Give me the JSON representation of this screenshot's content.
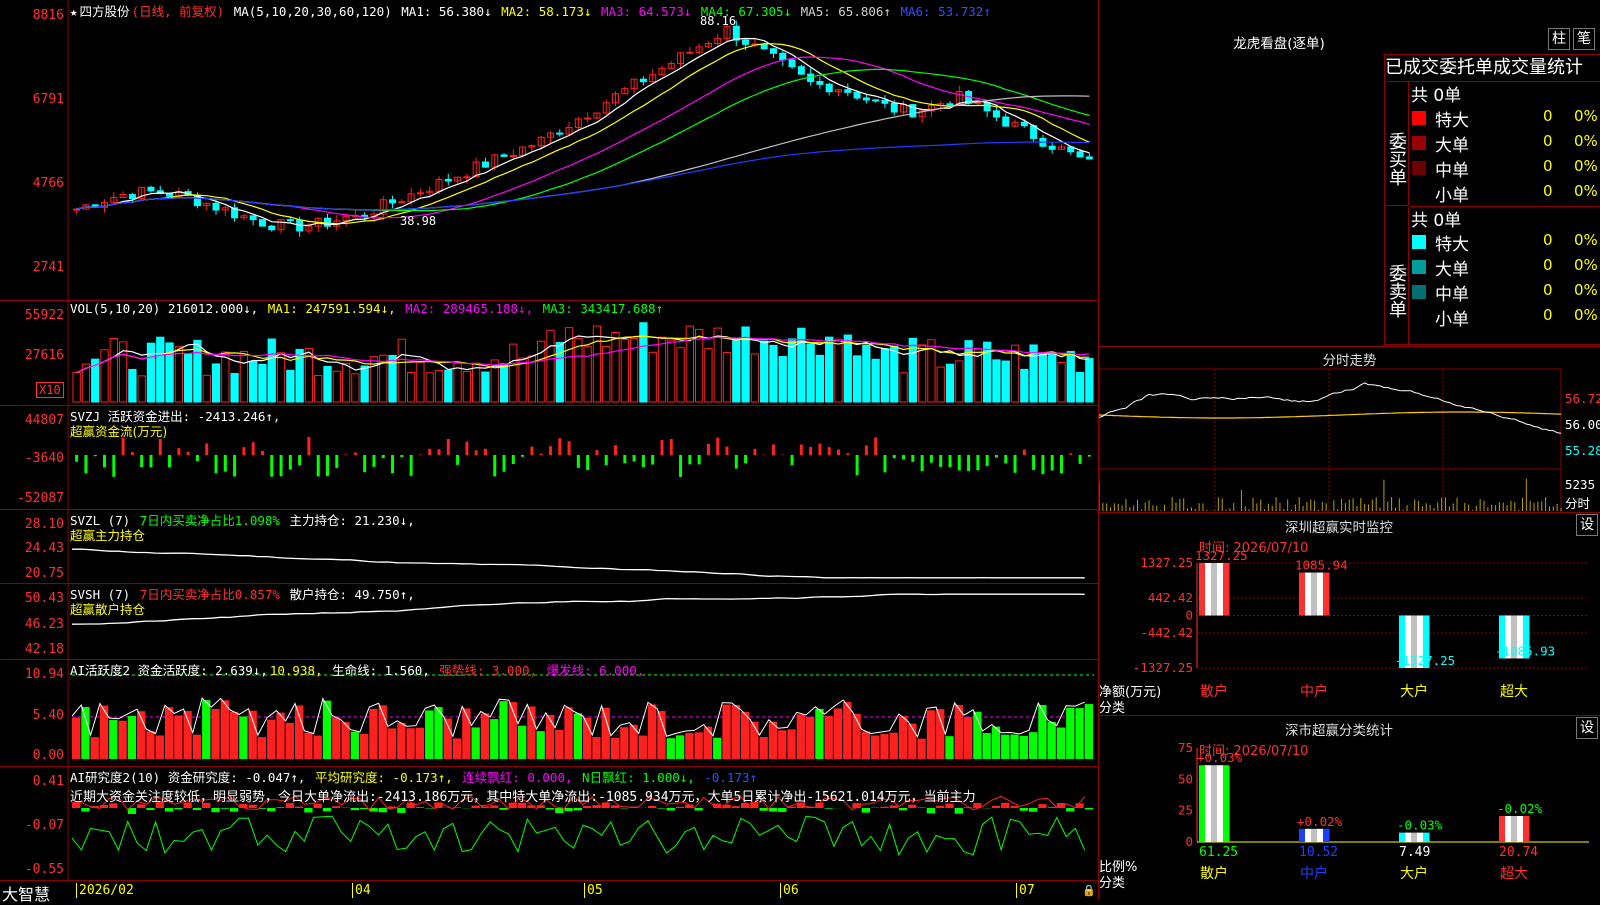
{
  "kline": {
    "star": "★",
    "name": "四方股份",
    "mode": "(日线, 前复权)",
    "ma_label": "MA(5,10,20,30,60,120)",
    "ma1": "MA1: 56.380↓",
    "ma2": "MA2: 58.173↓",
    "ma3": "MA3: 64.573↓",
    "ma4": "MA4: 67.305↓",
    "ma5": "MA5: 65.806↑",
    "ma6": "MA6: 53.732↑",
    "yticks": [
      "8816",
      "6791",
      "4766",
      "2741"
    ],
    "high_label": "88.16",
    "low_label": "38.98",
    "colors": {
      "ma1": "#ffffff",
      "ma2": "#ffff00",
      "ma3": "#ff00ff",
      "ma4": "#00ff00",
      "ma5": "#c0c0c0",
      "ma6": "#1e3cff",
      "up": "#ff2020",
      "down": "#00ffff"
    }
  },
  "vol": {
    "title": "VOL(5,10,20) 216012.000↓,",
    "ma1": "MA1: 247591.594↓,",
    "ma2": "MA2: 289465.188↓,",
    "ma3": "MA3: 343417.688↑",
    "yticks": [
      "55922",
      "27616"
    ],
    "unit": "X10"
  },
  "svzj": {
    "title": "SVZJ  活跃资金进出: -2413.246↑,",
    "sub": "超赢资金流(万元)",
    "yticks": [
      "44807",
      "-3640",
      "-52087"
    ]
  },
  "svzl": {
    "title": "SVZL (7)",
    "t2": "7日内买卖净占比1.098%",
    "t3": "主力持仓: 21.230↓,",
    "sub": "超赢主力持仓",
    "yticks": [
      "28.10",
      "24.43",
      "20.75"
    ]
  },
  "svsh": {
    "title": "SVSH (7)",
    "t2": "7日内买卖净占比0.857%",
    "t3": "散户持仓: 49.750↑,",
    "sub": "超赢散户持仓",
    "yticks": [
      "50.43",
      "46.23",
      "42.18"
    ]
  },
  "ai_active": {
    "title": "AI活跃度2 资金活跃度: 2.639↓,",
    "t2": "10.938,",
    "t3": "生命线: 1.560,",
    "t4": "强势线: 3.000,",
    "t5": "爆发线: 6.000,",
    "yticks": [
      "10.94",
      "5.40",
      "0.00"
    ]
  },
  "ai_research": {
    "title": "AI研究度2(10) 资金研究度: -0.047↑,",
    "t2": "平均研究度: -0.173↑,",
    "t3": "连续飘红: 0.000,",
    "t4": "N日飘红: 1.000↓,",
    "t5": "-0.173↑",
    "comment": "近期大资金关注度较低，明显弱势，今日大单净流出:-2413.186万元，其中特大单净流出:-1085.934万元，大单5日累计净出-15621.014万元，当前主力",
    "yticks": [
      "0.41",
      "-0.07",
      "-0.55"
    ]
  },
  "bottom_axis": {
    "brand": "大智慧",
    "dates": [
      "2026/02",
      "04",
      "05",
      "06",
      "07"
    ]
  },
  "dragon": {
    "title": "龙虎看盘(逐单)",
    "btn1": "柱",
    "btn2": "笔",
    "tabs": "已成交委托单成交量统计",
    "buy_label": "委买单",
    "sell_label": "委卖单",
    "buy_total": "共 0单",
    "sell_total": "共 0单",
    "buy_rows": [
      {
        "label": "特大",
        "value": "0",
        "pct": "0%",
        "color": "#ff0000"
      },
      {
        "label": "大单",
        "value": "0",
        "pct": "0%",
        "color": "#9b0000"
      },
      {
        "label": "中单",
        "value": "0",
        "pct": "0%",
        "color": "#6b0000"
      },
      {
        "label": "小单",
        "value": "0",
        "pct": "0%",
        "color": "#000000"
      }
    ],
    "sell_rows": [
      {
        "label": "特大",
        "value": "0",
        "pct": "0%",
        "color": "#00ffff"
      },
      {
        "label": "大单",
        "value": "0",
        "pct": "0%",
        "color": "#009c9c"
      },
      {
        "label": "中单",
        "value": "0",
        "pct": "0%",
        "color": "#007070"
      },
      {
        "label": "小单",
        "value": "0",
        "pct": "0%",
        "color": "#000000"
      }
    ]
  },
  "intraday": {
    "title": "分时走势",
    "prices": [
      "56.72",
      "56.00",
      "55.28"
    ],
    "vol": "5235",
    "vol_label": "分时"
  },
  "sz_monitor": {
    "title": "深圳超赢实时监控",
    "btn": "设",
    "time": "时间: 2026/07/10",
    "yticks": [
      "1327.25",
      "442.42",
      "0",
      "-442.42",
      "-1327.25"
    ],
    "ylabel": "净额(万元)",
    "xlabel": "分类",
    "categories": [
      "散户",
      "中户",
      "大户",
      "超大"
    ],
    "bar_labels": [
      "1327.25",
      "1085.94",
      "-1327.25",
      "-1085.93"
    ]
  },
  "sz_class": {
    "title": "深市超赢分类统计",
    "btn": "设",
    "time": "时间: 2026/07/10",
    "yticks": [
      "75",
      "50",
      "25",
      "0"
    ],
    "ylabel": "比例%",
    "xlabel": "分类",
    "categories": [
      "散户",
      "中户",
      "大户",
      "超大"
    ],
    "changes": [
      "+0.03%",
      "+0.02%",
      "-0.03%",
      "-0.02%"
    ],
    "values": [
      "61.25",
      "10.52",
      "7.49",
      "20.74"
    ]
  },
  "chart_data": [
    {
      "type": "bar",
      "title": "深圳超赢实时监控",
      "xlabel": "分类",
      "ylabel": "净额(万元)",
      "categories": [
        "散户",
        "中户",
        "大户",
        "超大"
      ],
      "values": [
        1327.25,
        1085.94,
        -1327.25,
        -1085.93
      ],
      "ylim": [
        -1327.25,
        1327.25
      ]
    },
    {
      "type": "bar",
      "title": "深市超赢分类统计",
      "xlabel": "分类",
      "ylabel": "比例%",
      "categories": [
        "散户",
        "中户",
        "大户",
        "超大"
      ],
      "values": [
        61.25,
        10.52,
        7.49,
        20.74
      ],
      "ylim": [
        0,
        75
      ]
    }
  ]
}
